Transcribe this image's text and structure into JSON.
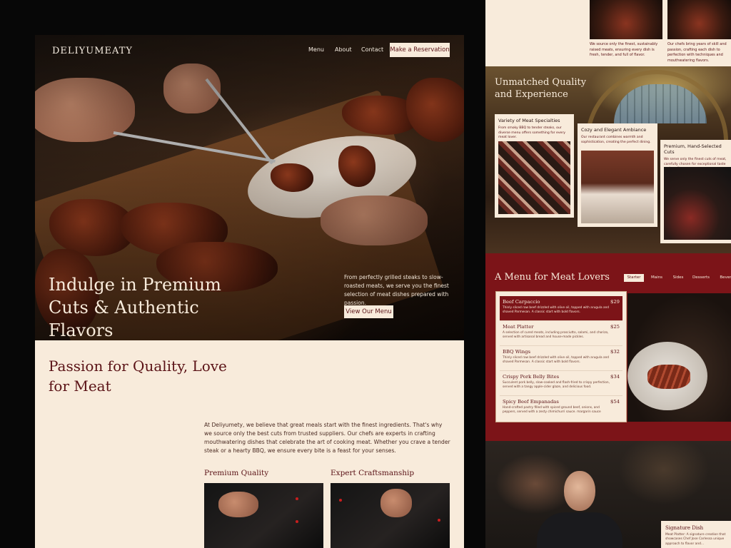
{
  "brand": "DELIYUMEATY",
  "nav": {
    "menu": "Menu",
    "about": "About",
    "contact": "Contact",
    "reserve": "Make a Reservation"
  },
  "hero": {
    "title": "Indulge in Premium Cuts & Authentic Flavors",
    "text": "From perfectly grilled steaks to slow-roasted meats, we serve you the finest selection of meat dishes prepared with passion.",
    "cta": "View Our Menu"
  },
  "passion": {
    "title": "Passion for Quality, Love for Meat",
    "body": "At Deliyumety, we believe that great meals start with the finest ingredients. That's why we source only the best cuts from trusted suppliers. Our chefs are experts in crafting mouthwatering dishes that celebrate the art of cooking meat. Whether you crave a tender steak or a hearty BBQ, we ensure every bite is a feast for your senses.",
    "features": [
      "Premium Quality",
      "Expert Craftsmanship"
    ]
  },
  "top_strip": {
    "left_text": "We source only the finest, sustainably raised meats, ensuring every dish is fresh, tender, and full of flavor.",
    "right_text": "Our chefs bring years of skill and passion, crafting each dish to perfection with techniques and mouthwatering flavors."
  },
  "quality": {
    "title": "Unmatched Quality and Experience",
    "cards": [
      {
        "title": "Variety of Meat Specialties",
        "text": "From smoky BBQ to tender steaks, our diverse menu offers something for every meat lover."
      },
      {
        "title": "Cozy and Elegant Ambiance",
        "text": "Our restaurant combines warmth and sophistication, creating the perfect dining."
      },
      {
        "title": "Premium, Hand-Selected Cuts",
        "text": "We serve only the finest cuts of meat, carefully chosen for exceptional taste and quality."
      }
    ]
  },
  "menu": {
    "title": "A Menu for Meat Lovers",
    "tabs": [
      "Starter",
      "Mains",
      "Sides",
      "Desserts",
      "Beverages"
    ],
    "items": [
      {
        "name": "Beef Carpaccio",
        "price": "$29",
        "desc": "Thinly sliced raw beef drizzled with olive oil, topped with arugula and shaved Parmesan. A classic start with bold flavors."
      },
      {
        "name": "Meat Platter",
        "price": "$25",
        "desc": "A selection of cured meats, including prosciutto, salami, and chorizo, served with artisanal bread and house-made pickles."
      },
      {
        "name": "BBQ Wings",
        "price": "$32",
        "desc": "Thinly sliced raw beef drizzled with olive oil, topped with arugula and shaved Parmesan. A classic start with bold flavors."
      },
      {
        "name": "Crispy Pork Belly Bites",
        "price": "$34",
        "desc": "Succulent pork belly, slow-cooked and flash-fried to crispy perfection, served with a tangy apple-cider glaze, and delicious food."
      },
      {
        "name": "Spicy Beef Empanadas",
        "price": "$54",
        "desc": "Hand-crafted pastry filled with spiced ground beef, onions, and peppers, served with a zesty chimichurri sauce. margarin sauce"
      }
    ]
  },
  "signature": {
    "title": "Signature Dish",
    "text": "Meat Platter: A signature creation that showcases Chef Jose Carlessa unique approach to flavor and..."
  }
}
